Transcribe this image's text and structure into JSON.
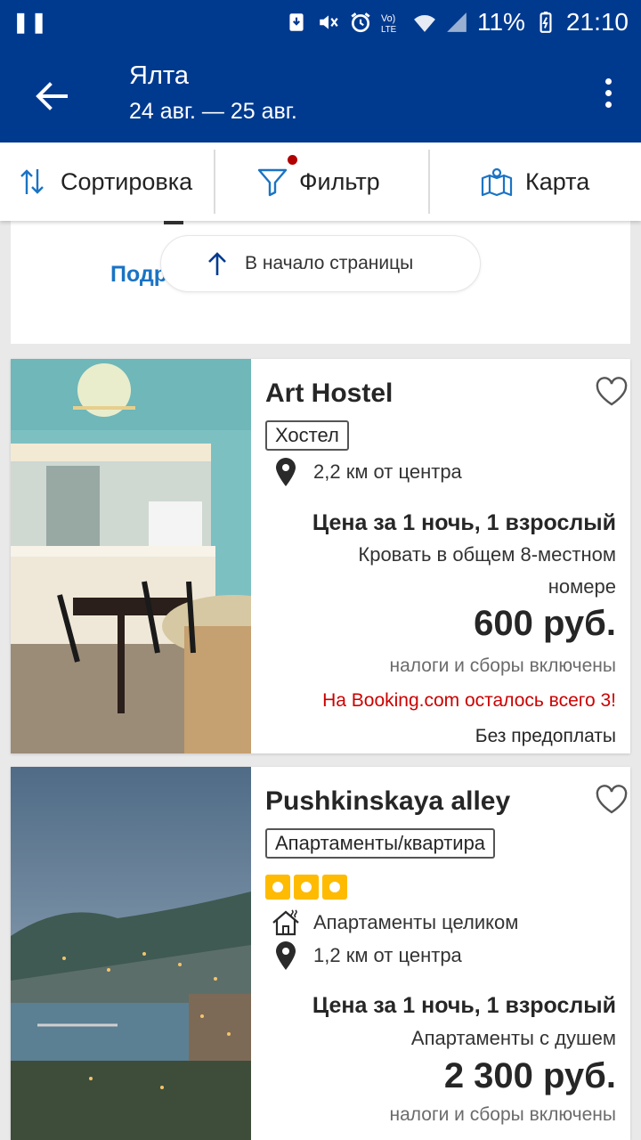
{
  "status_bar": {
    "battery_text": "11%",
    "time": "21:10",
    "icons": [
      "pause-icon",
      "download-icon",
      "mute-icon",
      "alarm-icon",
      "volte-icon",
      "wifi-icon",
      "signal-icon",
      "battery-icon"
    ]
  },
  "app_bar": {
    "title": "Ялта",
    "dates": "24 авг. — 25 авг."
  },
  "toolbar": {
    "sort_label": "Сортировка",
    "filter_label": "Фильтр",
    "map_label": "Карта"
  },
  "previous_card": {
    "link_text": "Подр"
  },
  "scroll_top_label": "В начало страницы",
  "listings": [
    {
      "name": "Art Hostel",
      "type": "Хостел",
      "distance": "2,2 км от центра",
      "price_title": "Цена за 1 ночь, 1 взрослый",
      "room_line1": "Кровать в общем 8-местном",
      "room_line2": "номере",
      "price": "600 руб.",
      "taxes": "налоги и сборы включены",
      "urgency": "На Booking.com осталось всего 3!",
      "no_prepay": "Без предоплаты"
    },
    {
      "name": "Pushkinskaya alley",
      "type": "Апартаменты/квартира",
      "rating": 3,
      "property_kind": "Апартаменты целиком",
      "distance": "1,2 км от центра",
      "price_title": "Цена за 1 ночь, 1 взрослый",
      "room_line1": "Апартаменты с душем",
      "price": "2 300 руб.",
      "taxes": "налоги и сборы включены"
    }
  ],
  "colors": {
    "brand_blue": "#003a8f",
    "link_blue": "#1a73c4",
    "urgency_red": "#cc0000",
    "star_yellow": "#febb02"
  }
}
